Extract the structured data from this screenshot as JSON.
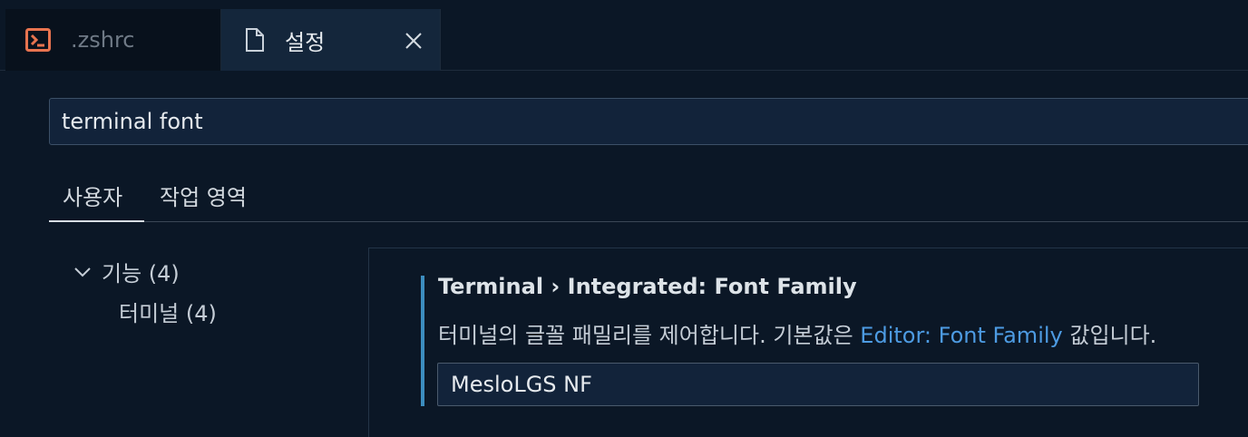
{
  "tabs": {
    "zshrc": {
      "label": ".zshrc",
      "icon": "terminal-icon",
      "icon_color": "#e8744f"
    },
    "settings": {
      "label": "설정",
      "icon": "file-icon"
    }
  },
  "search": {
    "value": "terminal font"
  },
  "scope_tabs": {
    "user": "사용자",
    "workspace": "작업 영역"
  },
  "tree": {
    "group": "기능 (4)",
    "child": "터미널 (4)"
  },
  "setting": {
    "title": "Terminal › Integrated: Font Family",
    "desc_before": "터미널의 글꼴 패밀리를 제어합니다. 기본값은 ",
    "desc_link": "Editor: Font Family",
    "desc_after": " 값입니다.",
    "value": "MesloLGS NF"
  },
  "colors": {
    "background": "#0b1726",
    "active_tab": "#14263b",
    "accent_bar": "#3c8dbf",
    "link": "#4d9be2"
  }
}
